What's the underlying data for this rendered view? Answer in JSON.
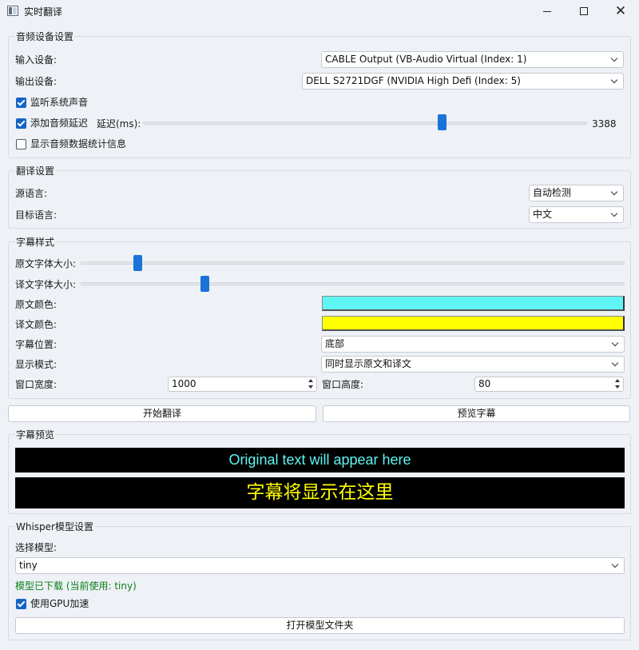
{
  "window": {
    "title": "实时翻译"
  },
  "audio": {
    "title": "音频设备设置",
    "input_label": "输入设备:",
    "input_value": "CABLE Output (VB-Audio Virtual  (Index: 1)",
    "output_label": "输出设备:",
    "output_value": "DELL S2721DGF (NVIDIA High Defi (Index: 5)",
    "monitor_label": "监听系统声音",
    "monitor_checked": true,
    "delay_label": "添加音频延迟",
    "delay_checked": true,
    "delay_ms_label": "延迟(ms):",
    "delay_value": "3388",
    "stats_label": "显示音频数据统计信息",
    "stats_checked": false
  },
  "translate": {
    "title": "翻译设置",
    "source_label": "源语言:",
    "source_value": "自动检测",
    "target_label": "目标语言:",
    "target_value": "中文"
  },
  "subtitle": {
    "title": "字幕样式",
    "orig_size_label": "原文字体大小:",
    "trans_size_label": "译文字体大小:",
    "orig_color_label": "原文颜色:",
    "orig_color": "#5ff5f5",
    "trans_color_label": "译文颜色:",
    "trans_color": "#ffff00",
    "position_label": "字幕位置:",
    "position_value": "底部",
    "mode_label": "显示模式:",
    "mode_value": "同时显示原文和译文",
    "width_label": "窗口宽度:",
    "width_value": "1000",
    "height_label": "窗口高度:",
    "height_value": "80"
  },
  "actions": {
    "start": "开始翻译",
    "preview": "预览字幕"
  },
  "preview": {
    "title": "字幕预览",
    "original_text": "Original text will appear here",
    "translated_text": "字幕将显示在这里"
  },
  "whisper": {
    "title": "Whisper模型设置",
    "select_label": "选择模型:",
    "model_value": "tiny",
    "status": "模型已下载 (当前使用: tiny)",
    "gpu_label": "使用GPU加速",
    "gpu_checked": true,
    "open_folder": "打开模型文件夹"
  }
}
